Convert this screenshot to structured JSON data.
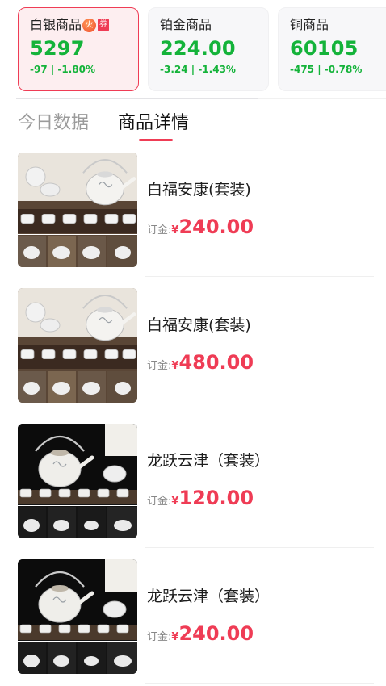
{
  "market": [
    {
      "name": "白银商品",
      "price": "5297",
      "change": "-97 | -1.80%",
      "hot_icon": "火",
      "badge": "券",
      "active": true
    },
    {
      "name": "铂金商品",
      "price": "224.00",
      "change": "-3.24 | -1.43%",
      "active": false
    },
    {
      "name": "铜商品",
      "price": "60105",
      "change": "-475 | -0.78%",
      "active": false
    }
  ],
  "tabs": {
    "today": "今日数据",
    "detail": "商品详情",
    "active": "detail"
  },
  "products": [
    {
      "title": "白福安康(套装)",
      "deposit_label": "订金:",
      "currency": "¥",
      "price": "240.00",
      "scene": "white-set"
    },
    {
      "title": "白福安康(套装)",
      "deposit_label": "订金:",
      "currency": "¥",
      "price": "480.00",
      "scene": "white-set"
    },
    {
      "title": "龙跃云津（套装）",
      "deposit_label": "订金:",
      "currency": "¥",
      "price": "120.00",
      "scene": "dark-set"
    },
    {
      "title": "龙跃云津（套装）",
      "deposit_label": "订金:",
      "currency": "¥",
      "price": "240.00",
      "scene": "dark-set"
    }
  ],
  "colors": {
    "accent": "#ef3c55",
    "down": "#14b33a",
    "muted": "#9b9b9b"
  }
}
